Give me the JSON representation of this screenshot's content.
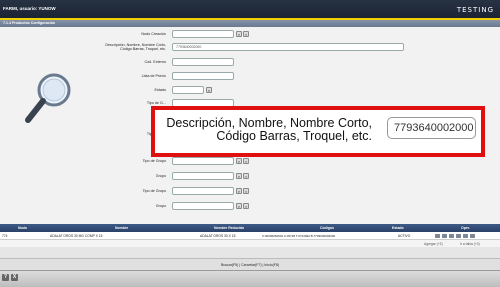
{
  "app": {
    "title": "FARMI, usuario: YUNOW",
    "environment": "TESTING"
  },
  "breadcrumb": "7.1.4 Productos Configuración",
  "form": {
    "nodo_creacion": {
      "label": "Nodo Creación"
    },
    "descripcion": {
      "label_line1": "Descripción, Nombre, Nombre Corto,",
      "label_line2": "Código Barras, Troquel, etc.",
      "value": "7793640002000"
    },
    "cod_externo": {
      "label": "Cód. Externo"
    },
    "lista_precio": {
      "label": "Lista de Precio"
    },
    "estado": {
      "label": "Estado"
    },
    "tipo_grupo_1": {
      "label": "Tipo de G..."
    },
    "tipo_grupo_2": {
      "label": "Tipo de G..."
    },
    "tipo_grupo_3": {
      "label": "Tipo de Grupo"
    },
    "grupo_1": {
      "label": "Grupo"
    },
    "tipo_grupo_4": {
      "label": "Tipo de Grupo"
    },
    "grupo_2": {
      "label": "Grupo"
    }
  },
  "callout": {
    "label_line1": "Descripción, Nombre, Nombre Corto,",
    "label_line2": "Código Barras, Troquel, etc.",
    "value": "7793640002000"
  },
  "grid": {
    "headers": [
      "Nodo",
      "Nombre",
      "Nombre Reducido",
      "Códigos",
      "Estado",
      "Oper."
    ],
    "row": {
      "nodo": "774",
      "nombre": "ADALAT OROS 30 MG COMP X 15",
      "nombre_reducido": "ADALAT OROS 30 X 15",
      "codigos": "X:00006052991 A:03748 T:3744992 B:7793640002000",
      "estado": "ACTIVO"
    },
    "footer_left": "Agregar (+Z)",
    "footer_right": "Ir a tabla (+0)"
  },
  "bottom_bar": {
    "text": "Buscar(F5) | Cancelar(F7) | Inicio(F8)"
  },
  "statusbar": {
    "help": "?",
    "close": "X"
  }
}
